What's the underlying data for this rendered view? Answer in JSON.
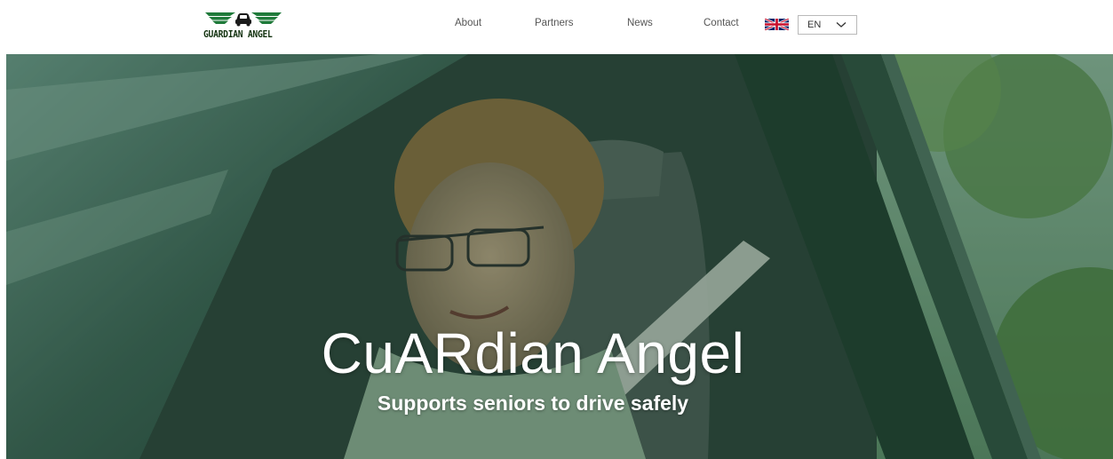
{
  "header": {
    "logo_text": "GUARDIAN ANGEL",
    "nav": [
      {
        "label": "About"
      },
      {
        "label": "Partners"
      },
      {
        "label": "News"
      },
      {
        "label": "Contact"
      }
    ],
    "language": {
      "selected": "EN",
      "flag_icon": "uk-flag-icon"
    }
  },
  "hero": {
    "title": "CuARdian Angel",
    "subtitle": "Supports seniors to drive safely"
  },
  "colors": {
    "brand_green": "#1f7a3a",
    "logo_text": "#12320f",
    "nav_text": "#555555",
    "hero_tint": "#18462e"
  }
}
